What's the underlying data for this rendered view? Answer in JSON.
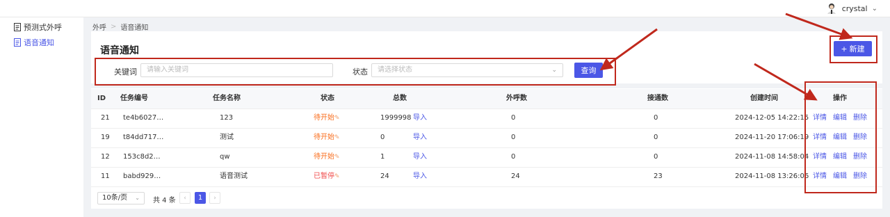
{
  "user": {
    "name": "crystal"
  },
  "sidebar": {
    "items": [
      {
        "label": "预测式外呼"
      },
      {
        "label": "语音通知"
      }
    ]
  },
  "breadcrumb": {
    "items": [
      "外呼",
      "语音通知"
    ],
    "separator": ">"
  },
  "page": {
    "title": "语音通知",
    "new_button": "新建",
    "new_button_icon": "+"
  },
  "filters": {
    "keyword_label": "关键词",
    "keyword_placeholder": "请输入关键词",
    "status_label": "状态",
    "status_placeholder": "请选择状态",
    "query_button": "查询"
  },
  "table": {
    "headers": [
      "ID",
      "任务编号",
      "任务名称",
      "状态",
      "总数",
      "外呼数",
      "接通数",
      "创建时间",
      "操作"
    ],
    "import_label": "导入",
    "actions": [
      "详情",
      "编辑",
      "删除"
    ],
    "rows": [
      {
        "id": "21",
        "code": "te4b6027…",
        "name": "123",
        "status": "待开始",
        "status_type": "pending",
        "total": "1999998",
        "called": "0",
        "connected": "0",
        "created": "2024-12-05 14:22:15"
      },
      {
        "id": "19",
        "code": "t84dd717…",
        "name": "测试",
        "status": "待开始",
        "status_type": "pending",
        "total": "0",
        "called": "0",
        "connected": "0",
        "created": "2024-11-20 17:06:19"
      },
      {
        "id": "12",
        "code": "153c8d2…",
        "name": "qw",
        "status": "待开始",
        "status_type": "pending",
        "total": "1",
        "called": "0",
        "connected": "0",
        "created": "2024-11-08 14:58:04"
      },
      {
        "id": "11",
        "code": "babd929…",
        "name": "语音测试",
        "status": "已暂停",
        "status_type": "paused",
        "total": "24",
        "called": "24",
        "connected": "23",
        "created": "2024-11-08 13:26:06"
      }
    ]
  },
  "pagination": {
    "page_size": "10条/页",
    "total_text": "共 4 条",
    "current_page": "1",
    "prev_icon": "‹",
    "next_icon": "›"
  },
  "colors": {
    "primary": "#4b57e6",
    "pending": "#fa6e1e",
    "paused": "#f04a4a",
    "annotation": "#c0281c"
  }
}
